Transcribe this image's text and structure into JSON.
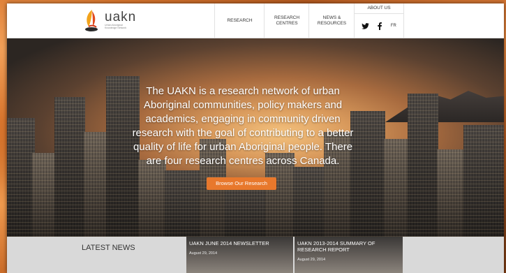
{
  "header": {
    "logo": {
      "name": "uakn",
      "tagline": "Urban Aboriginal Knowledge Network"
    },
    "nav": [
      {
        "label": "RESEARCH"
      },
      {
        "label": "RESEARCH CENTRES"
      },
      {
        "label": "NEWS & RESOURCES"
      }
    ],
    "about_label": "ABOUT US",
    "social": {
      "twitter": "twitter-icon",
      "facebook": "facebook-icon"
    },
    "language_label": "FR"
  },
  "hero": {
    "text": "The UAKN is a research network of urban Aboriginal communities, policy makers and academics, engaging in community driven research with the goal of contributing to a better quality of life for urban Aboriginal people. There are four research centres across Canada.",
    "button_label": "Browse Our Research"
  },
  "news": {
    "title": "LATEST NEWS",
    "items": [
      {
        "title": "UAKN JUNE 2014 NEWSLETTER",
        "date": "August 29, 2014"
      },
      {
        "title": "UAKN 2013-2014 SUMMARY OF RESEARCH REPORT",
        "date": "August 29, 2014"
      }
    ]
  },
  "colors": {
    "accent": "#e8782c",
    "header_bg": "#ffffff",
    "news_bg": "#d9d9d9"
  }
}
